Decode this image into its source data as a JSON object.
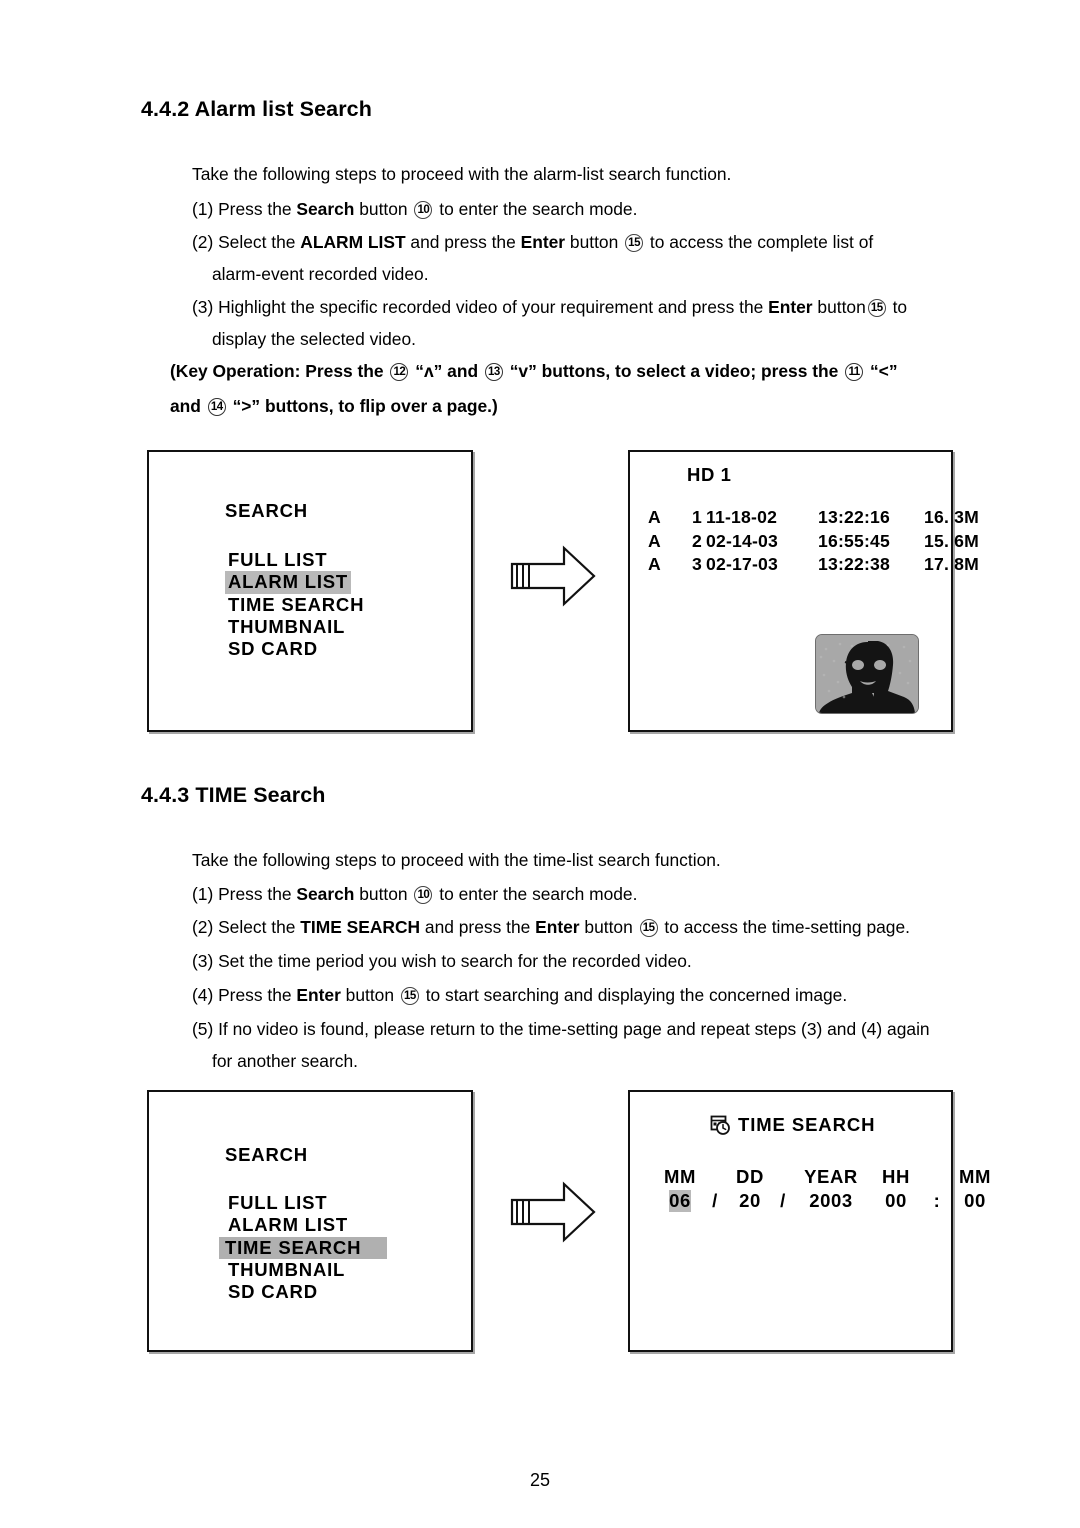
{
  "page": {
    "number": "25"
  },
  "sections": {
    "alarm_list": {
      "heading": "4.4.2 Alarm list Search",
      "intro": "Take the following steps to proceed with the alarm-list search function.",
      "steps": [
        {
          "prefix": "(1) Press the ",
          "bold1": "Search",
          "mid1": " button ",
          "key1": "10",
          "tail": " to enter the search mode."
        },
        {
          "prefix": "(2) Select the ",
          "bold1": "ALARM LIST",
          "mid1": " and press the ",
          "bold2": "Enter",
          "mid2": " button ",
          "key1": "15",
          "tail": " to access the complete list of",
          "wrap": "alarm-event recorded video."
        },
        {
          "prefix": "(3) Highlight the specific recorded video of your requirement and press the ",
          "bold1": "Enter",
          "mid1": " button",
          "key1": "15",
          "tail": " to",
          "wrap": "display the selected video."
        }
      ],
      "key_operation": {
        "line1_a": "(Key Operation: Press the ",
        "key_up": "12",
        "line1_b": " “ʌ” and ",
        "key_down": "13",
        "line1_c": " “v” buttons, to select a video; press the ",
        "key_left": "11",
        "line1_d": " “<”",
        "line2_a": "and ",
        "key_right": "14",
        "line2_b": " “>” buttons, to flip over a page.)"
      }
    },
    "time_search": {
      "heading": "4.4.3 TIME Search",
      "intro": "Take the following steps to proceed with the time-list search function.",
      "steps": [
        {
          "prefix": "(1) Press the ",
          "bold1": "Search",
          "mid1": " button ",
          "key1": "10",
          "tail": " to enter the search mode."
        },
        {
          "prefix": "(2) Select the ",
          "bold1": "TIME SEARCH",
          "mid1": " and press the ",
          "bold2": "Enter",
          "mid2": " button ",
          "key1": "15",
          "tail": " to access the time-setting page."
        },
        {
          "prefix": "(3) Set the time period you wish to search for the recorded video."
        },
        {
          "prefix": "(4) Press the ",
          "bold1": "Enter",
          "mid1": " button ",
          "key1": "15",
          "tail": " to start searching and displaying the concerned image."
        },
        {
          "prefix": "(5) If no video is found, please return to the time-setting page and repeat steps (3) and (4) again",
          "wrap": "for another search."
        }
      ]
    }
  },
  "osd": {
    "search_menu_alarm": {
      "title": "SEARCH",
      "items": [
        {
          "label": "FULL LIST",
          "selected": false
        },
        {
          "label": "ALARM LIST",
          "selected": true
        },
        {
          "label": "TIME SEARCH",
          "selected": false
        },
        {
          "label": "THUMBNAIL",
          "selected": false
        },
        {
          "label": "SD CARD",
          "selected": false
        }
      ]
    },
    "search_menu_time": {
      "title": "SEARCH",
      "items": [
        {
          "label": "FULL LIST",
          "selected": false
        },
        {
          "label": "ALARM LIST",
          "selected": false
        },
        {
          "label": "TIME SEARCH",
          "selected": true
        },
        {
          "label": "THUMBNAIL",
          "selected": false
        },
        {
          "label": "SD CARD",
          "selected": false
        }
      ]
    },
    "hd_list": {
      "title": "HD 1",
      "rows": [
        {
          "type": "A",
          "index": "1",
          "date": "11-18-02",
          "time": "13:22:16",
          "size": "16. 3M"
        },
        {
          "type": "A",
          "index": "2",
          "date": "02-14-03",
          "time": "16:55:45",
          "size": "15. 6M"
        },
        {
          "type": "A",
          "index": "3",
          "date": "02-17-03",
          "time": "13:22:38",
          "size": "17. 8M"
        }
      ],
      "thumbnail_icon": "portrait-thumbnail"
    },
    "time_search_panel": {
      "icon": "calendar-clock-icon",
      "title": "TIME SEARCH",
      "labels": {
        "mm": "MM",
        "dd": "DD",
        "year": "YEAR",
        "hh": "HH",
        "min": "MM"
      },
      "values": {
        "mm": "06",
        "sep1": "/",
        "dd": "20",
        "sep2": "/",
        "year": "2003",
        "hh": "00",
        "colon": ":",
        "min": "00"
      },
      "highlighted_field": "mm"
    }
  },
  "icons": {
    "arrow_right": "arrow-right-icon"
  },
  "colors": {
    "highlight": "#b9b9b9",
    "ink": "#000000",
    "paper": "#ffffff",
    "thumb_bg": "#a8a8a8"
  }
}
